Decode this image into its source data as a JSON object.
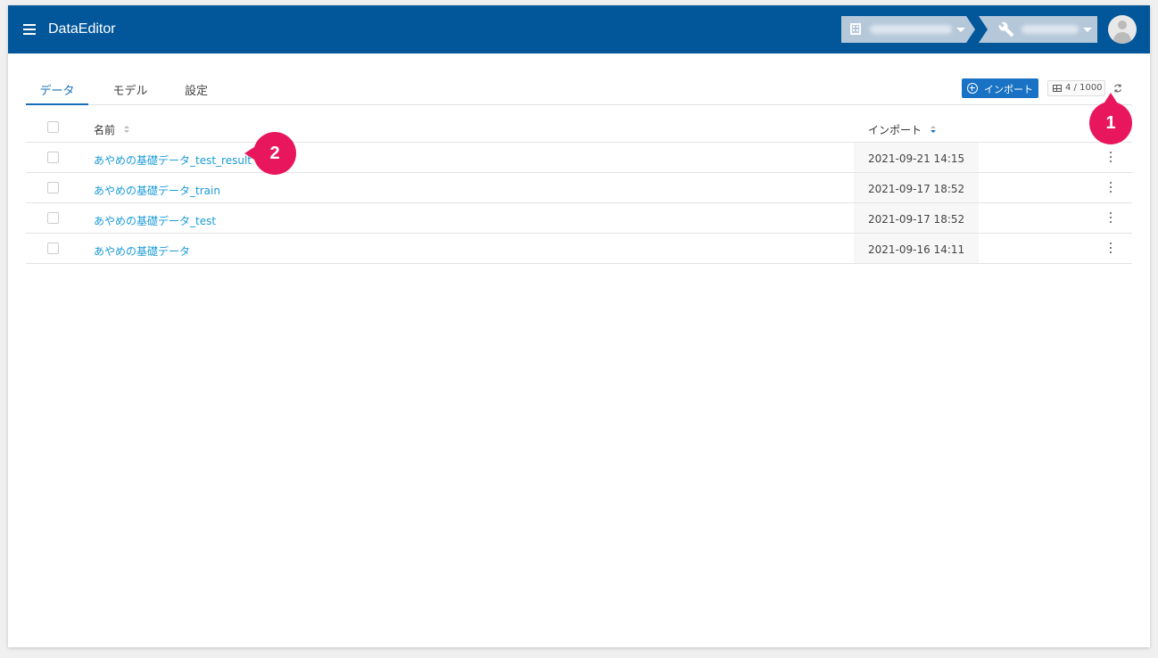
{
  "app": {
    "title": "DataEditor"
  },
  "tabs": [
    {
      "label": "データ",
      "active": true
    },
    {
      "label": "モデル",
      "active": false
    },
    {
      "label": "設定",
      "active": false
    }
  ],
  "toolbar": {
    "import_label": "インポート",
    "count": "4 / 1000"
  },
  "table": {
    "headers": {
      "name": "名前",
      "import": "インポート"
    },
    "rows": [
      {
        "name": "あやめの基礎データ_test_result",
        "date": "2021-09-21 14:15"
      },
      {
        "name": "あやめの基礎データ_train",
        "date": "2021-09-17 18:52"
      },
      {
        "name": "あやめの基礎データ_test",
        "date": "2021-09-17 18:52"
      },
      {
        "name": "あやめの基礎データ",
        "date": "2021-09-16 14:11"
      }
    ]
  },
  "callouts": {
    "first": "1",
    "second": "2"
  },
  "colors": {
    "appbar": "#02579b",
    "accent": "#1a72c4",
    "link": "#1a9bd7",
    "callout": "#e8175d"
  }
}
